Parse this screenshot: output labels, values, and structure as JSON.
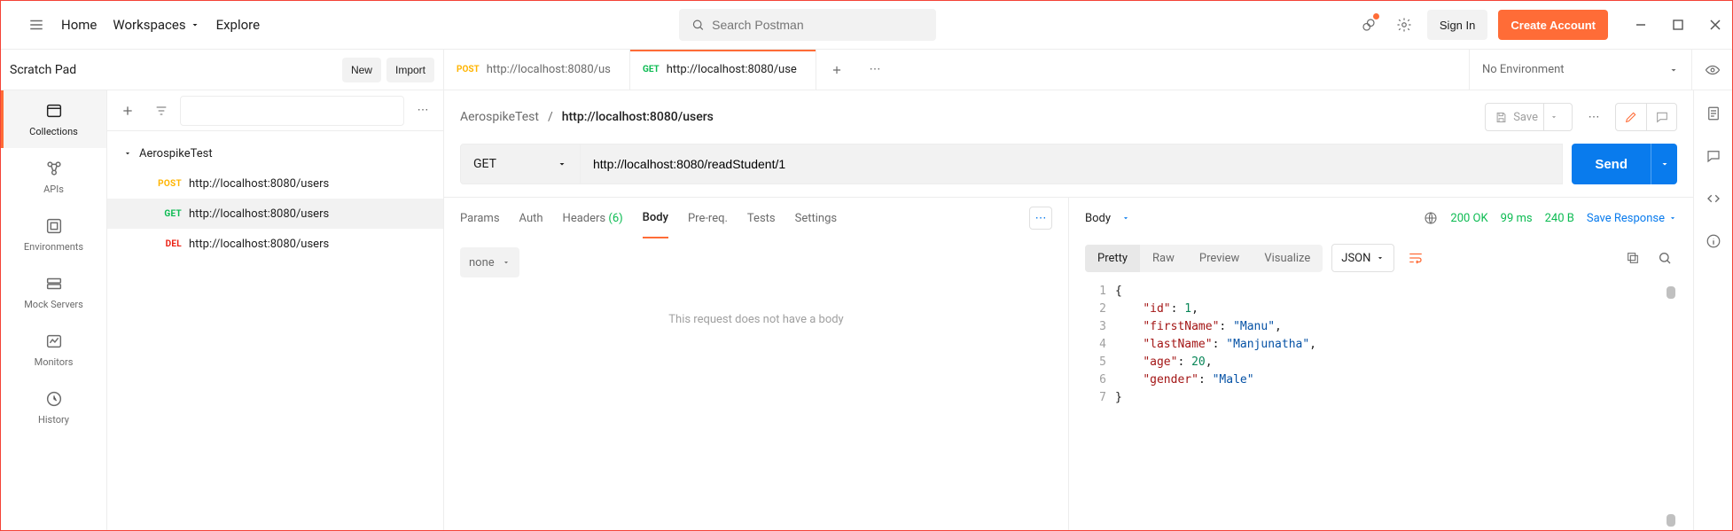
{
  "topbar": {
    "home": "Home",
    "workspaces": "Workspaces",
    "explore": "Explore",
    "search_placeholder": "Search Postman",
    "sign_in": "Sign In",
    "create_account": "Create Account"
  },
  "scratch": {
    "title": "Scratch Pad",
    "new": "New",
    "import": "Import"
  },
  "rail": [
    {
      "label": "Collections"
    },
    {
      "label": "APIs"
    },
    {
      "label": "Environments"
    },
    {
      "label": "Mock Servers"
    },
    {
      "label": "Monitors"
    },
    {
      "label": "History"
    }
  ],
  "tree": {
    "root": "AerospikeTest",
    "items": [
      {
        "method": "POST",
        "url": "http://localhost:8080/users"
      },
      {
        "method": "GET",
        "url": "http://localhost:8080/users"
      },
      {
        "method": "DEL",
        "url": "http://localhost:8080/users"
      }
    ]
  },
  "tabs": [
    {
      "method": "POST",
      "label": "http://localhost:8080/us"
    },
    {
      "method": "GET",
      "label": "http://localhost:8080/use"
    }
  ],
  "env": {
    "selected": "No Environment"
  },
  "request": {
    "collection": "AerospikeTest",
    "title": "http://localhost:8080/users",
    "save": "Save",
    "method": "GET",
    "url": "http://localhost:8080/readStudent/1",
    "send": "Send",
    "subtabs": {
      "params": "Params",
      "auth": "Auth",
      "headers": "Headers",
      "headers_count": "(6)",
      "body": "Body",
      "prereq": "Pre-req.",
      "tests": "Tests",
      "settings": "Settings"
    },
    "body_type": "none",
    "empty_msg": "This request does not have a body"
  },
  "response": {
    "label": "Body",
    "status": "200 OK",
    "time": "99 ms",
    "size": "240 B",
    "save": "Save Response",
    "views": {
      "pretty": "Pretty",
      "raw": "Raw",
      "preview": "Preview",
      "visualize": "Visualize"
    },
    "lang": "JSON",
    "json": {
      "id": 1,
      "firstName": "Manu",
      "lastName": "Manjunatha",
      "age": 20,
      "gender": "Male"
    }
  }
}
